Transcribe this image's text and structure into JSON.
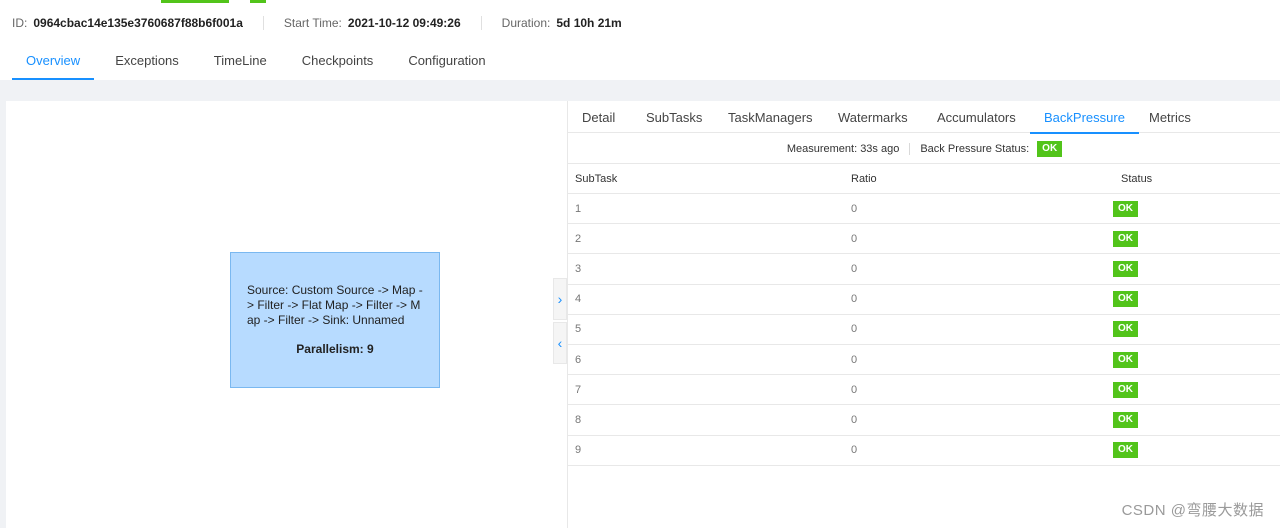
{
  "info": {
    "id_label": "ID:",
    "id_value": "0964cbac14e135e3760687f88b6f001a",
    "start_label": "Start Time:",
    "start_value": "2021-10-12 09:49:26",
    "duration_label": "Duration:",
    "duration_value": "5d 10h 21m"
  },
  "main_tabs": [
    "Overview",
    "Exceptions",
    "TimeLine",
    "Checkpoints",
    "Configuration"
  ],
  "node": {
    "description": "Source: Custom Source -> Map -> Filter -> Flat Map -> Filter -> Map -> Filter -> Sink: Unnamed",
    "parallelism": "Parallelism: 9"
  },
  "toggles": {
    "expand": "›",
    "collapse": "‹"
  },
  "sub_tabs": [
    "Detail",
    "SubTasks",
    "TaskManagers",
    "Watermarks",
    "Accumulators",
    "BackPressure",
    "Metrics"
  ],
  "measurement": {
    "text": "Measurement: 33s ago",
    "status_label": "Back Pressure Status:",
    "status_value": "OK"
  },
  "table": {
    "headers": [
      "SubTask",
      "Ratio",
      "Status"
    ],
    "rows": [
      {
        "subtask": "1",
        "ratio": "0",
        "status": "OK"
      },
      {
        "subtask": "2",
        "ratio": "0",
        "status": "OK"
      },
      {
        "subtask": "3",
        "ratio": "0",
        "status": "OK"
      },
      {
        "subtask": "4",
        "ratio": "0",
        "status": "OK"
      },
      {
        "subtask": "5",
        "ratio": "0",
        "status": "OK"
      },
      {
        "subtask": "6",
        "ratio": "0",
        "status": "OK"
      },
      {
        "subtask": "7",
        "ratio": "0",
        "status": "OK"
      },
      {
        "subtask": "8",
        "ratio": "0",
        "status": "OK"
      },
      {
        "subtask": "9",
        "ratio": "0",
        "status": "OK"
      }
    ]
  },
  "watermark": "CSDN @弯腰大数据",
  "colors": {
    "accent": "#1890ff",
    "ok": "#52c41a",
    "node_fill": "#b7dbff"
  }
}
